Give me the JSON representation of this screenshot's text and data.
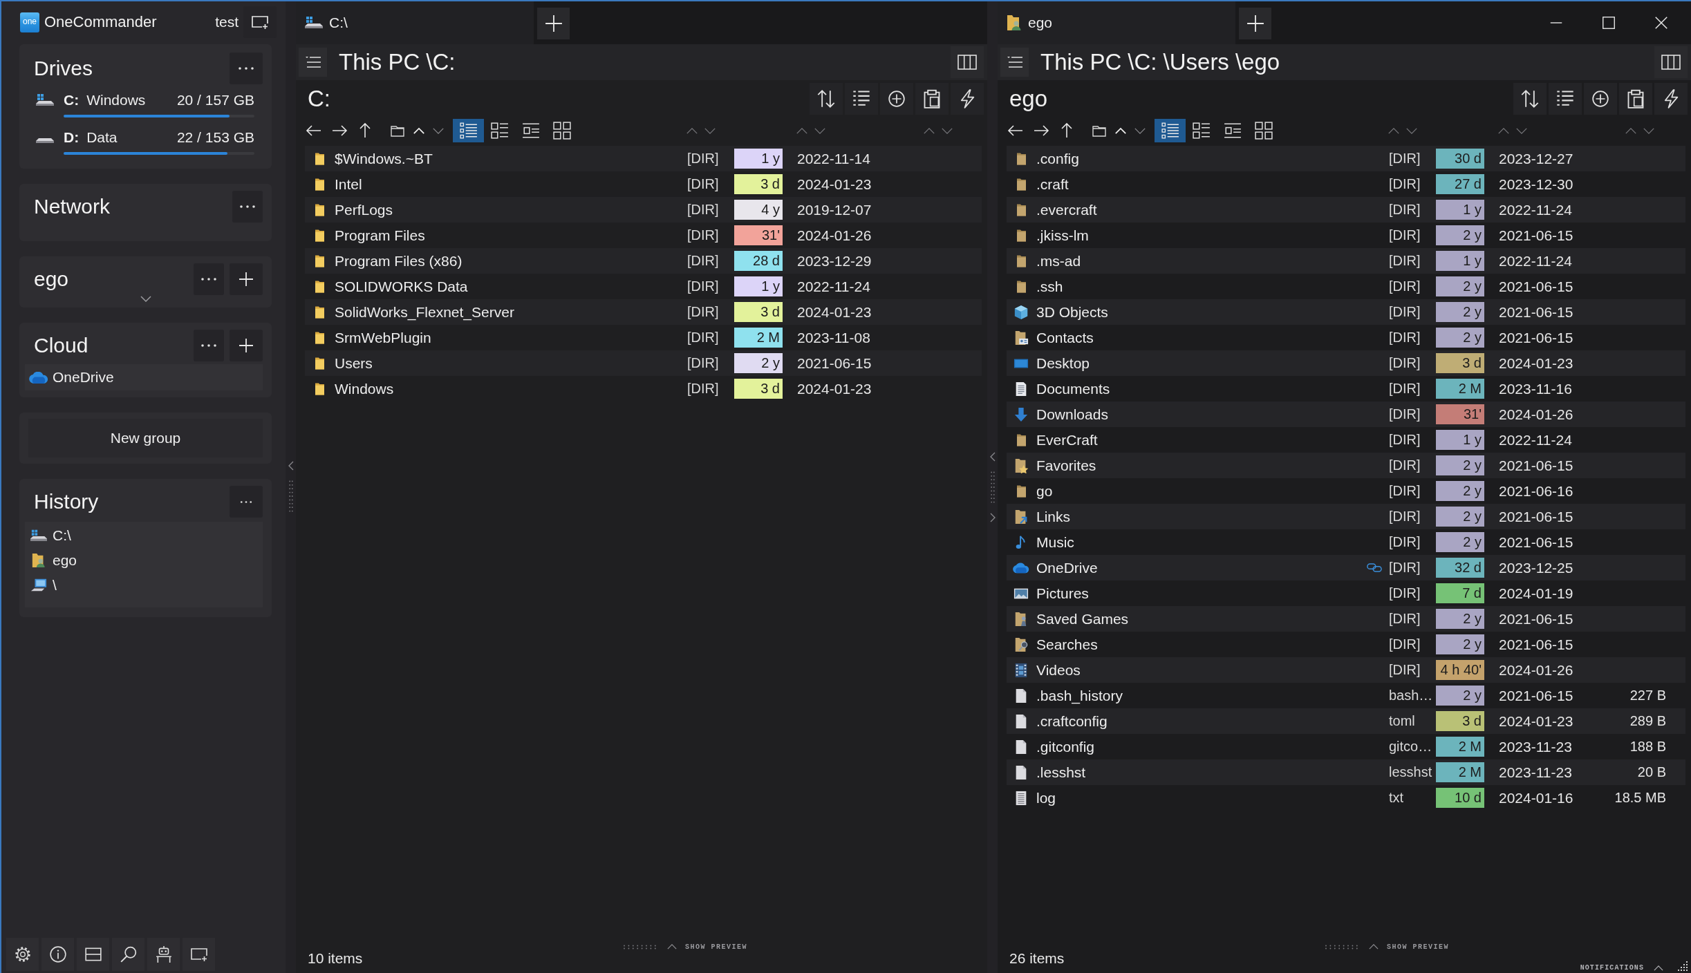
{
  "window": {
    "notifications": "NOTIFICATIONS"
  },
  "sidebar": {
    "logo": "one",
    "app_name": "OneCommander",
    "workspace": "test",
    "drives": {
      "title": "Drives",
      "items": [
        {
          "kind": "system",
          "letter": "C:",
          "label": "Windows",
          "space": "20 / 157 GB",
          "level": 0.87
        },
        {
          "kind": "data",
          "letter": "D:",
          "label": "Data",
          "space": "22 / 153 GB",
          "level": 0.86
        }
      ]
    },
    "groups": [
      {
        "title": "Network",
        "addable": false,
        "expanded": true
      },
      {
        "title": "ego",
        "addable": true,
        "expanded": false
      },
      {
        "title": "Cloud",
        "addable": true,
        "expanded": true,
        "items": [
          {
            "kind": "cloud",
            "label": "OneDrive"
          }
        ]
      }
    ],
    "new_group": "New group",
    "history": {
      "title": "History",
      "items": [
        {
          "kind": "drive",
          "label": "C:\\"
        },
        {
          "kind": "user-folder",
          "label": "ego"
        },
        {
          "kind": "computer",
          "label": "\\"
        }
      ]
    }
  },
  "panes": [
    {
      "active": true,
      "tabs": [
        {
          "kind": "drive",
          "label": "C:\\"
        }
      ],
      "breadcrumb": [
        "This PC",
        "\\C:"
      ],
      "folder": "C:",
      "view_modes": [
        {
          "kind": "details",
          "selected": true
        },
        {
          "kind": "tiles",
          "selected": false
        },
        {
          "kind": "tree",
          "selected": false
        },
        {
          "kind": "grid",
          "selected": false
        }
      ],
      "rows": [
        {
          "kind": "folder",
          "name": "$Windows.~BT",
          "type": "[DIR]",
          "linked": false,
          "age": "1 y",
          "color": "#dcd4f8",
          "date": "2022-11-14"
        },
        {
          "kind": "folder",
          "name": "Intel",
          "type": "[DIR]",
          "linked": false,
          "age": "3 d",
          "color": "#e3f29b",
          "date": "2024-01-23"
        },
        {
          "kind": "folder",
          "name": "PerfLogs",
          "type": "[DIR]",
          "linked": false,
          "age": "4 y",
          "color": "#e8e6ec",
          "date": "2019-12-07"
        },
        {
          "kind": "folder",
          "name": "Program Files",
          "type": "[DIR]",
          "linked": false,
          "age": "31'",
          "color": "#f2a39a",
          "date": "2024-01-26"
        },
        {
          "kind": "folder",
          "name": "Program Files (x86)",
          "type": "[DIR]",
          "linked": false,
          "age": "28 d",
          "color": "#8fe1ee",
          "date": "2023-12-29"
        },
        {
          "kind": "folder",
          "name": "SOLIDWORKS Data",
          "type": "[DIR]",
          "linked": false,
          "age": "1 y",
          "color": "#dcd4f8",
          "date": "2022-11-24"
        },
        {
          "kind": "folder",
          "name": "SolidWorks_Flexnet_Server",
          "type": "[DIR]",
          "linked": false,
          "age": "3 d",
          "color": "#e3f29b",
          "date": "2024-01-23"
        },
        {
          "kind": "folder",
          "name": "SrmWebPlugin",
          "type": "[DIR]",
          "linked": false,
          "age": "2 M",
          "color": "#8fe1ee",
          "date": "2023-11-08"
        },
        {
          "kind": "folder",
          "name": "Users",
          "type": "[DIR]",
          "linked": false,
          "age": "2 y",
          "color": "#e0dbf2",
          "date": "2021-06-15"
        },
        {
          "kind": "folder",
          "name": "Windows",
          "type": "[DIR]",
          "linked": false,
          "age": "3 d",
          "color": "#e3f29b",
          "date": "2024-01-23"
        }
      ],
      "status": "10 items",
      "preview": "SHOW PREVIEW"
    },
    {
      "active": false,
      "tabs": [
        {
          "kind": "user-folder",
          "label": "ego"
        }
      ],
      "breadcrumb": [
        "This PC",
        "\\C:",
        "\\Users",
        "\\ego"
      ],
      "folder": "ego",
      "view_modes": [
        {
          "kind": "details",
          "selected": true
        },
        {
          "kind": "tiles",
          "selected": false
        },
        {
          "kind": "tree",
          "selected": false
        },
        {
          "kind": "grid",
          "selected": false
        }
      ],
      "rows": [
        {
          "kind": "folder",
          "name": ".config",
          "type": "[DIR]",
          "linked": false,
          "age": "30 d",
          "color": "#6cb4bc",
          "date": "2023-12-27"
        },
        {
          "kind": "folder",
          "name": ".craft",
          "type": "[DIR]",
          "linked": false,
          "age": "27 d",
          "color": "#6cb4bc",
          "date": "2023-12-30"
        },
        {
          "kind": "folder",
          "name": ".evercraft",
          "type": "[DIR]",
          "linked": false,
          "age": "1 y",
          "color": "#a9a5c3",
          "date": "2022-11-24"
        },
        {
          "kind": "folder",
          "name": ".jkiss-lm",
          "type": "[DIR]",
          "linked": false,
          "age": "2 y",
          "color": "#a9a5c3",
          "date": "2021-06-15"
        },
        {
          "kind": "folder",
          "name": ".ms-ad",
          "type": "[DIR]",
          "linked": false,
          "age": "1 y",
          "color": "#a9a5c3",
          "date": "2022-11-24"
        },
        {
          "kind": "folder",
          "name": ".ssh",
          "type": "[DIR]",
          "linked": false,
          "age": "2 y",
          "color": "#a9a5c3",
          "date": "2021-06-15"
        },
        {
          "kind": "cube",
          "name": "3D Objects",
          "type": "[DIR]",
          "linked": false,
          "age": "2 y",
          "color": "#a9a5c3",
          "date": "2021-06-15"
        },
        {
          "kind": "contacts",
          "name": "Contacts",
          "type": "[DIR]",
          "linked": false,
          "age": "2 y",
          "color": "#a9a5c3",
          "date": "2021-06-15"
        },
        {
          "kind": "desktop",
          "name": "Desktop",
          "type": "[DIR]",
          "linked": false,
          "age": "3 d",
          "color": "#bfad75",
          "date": "2024-01-23"
        },
        {
          "kind": "document",
          "name": "Documents",
          "type": "[DIR]",
          "linked": false,
          "age": "2 M",
          "color": "#6cb4bc",
          "date": "2023-11-16"
        },
        {
          "kind": "download",
          "name": "Downloads",
          "type": "[DIR]",
          "linked": false,
          "age": "31'",
          "color": "#c47d77",
          "date": "2024-01-26"
        },
        {
          "kind": "folder",
          "name": "EverCraft",
          "type": "[DIR]",
          "linked": false,
          "age": "1 y",
          "color": "#a9a5c3",
          "date": "2022-11-24"
        },
        {
          "kind": "star-folder",
          "name": "Favorites",
          "type": "[DIR]",
          "linked": false,
          "age": "2 y",
          "color": "#a9a5c3",
          "date": "2021-06-15"
        },
        {
          "kind": "folder",
          "name": "go",
          "type": "[DIR]",
          "linked": false,
          "age": "2 y",
          "color": "#a9a5c3",
          "date": "2021-06-16"
        },
        {
          "kind": "link-folder",
          "name": "Links",
          "type": "[DIR]",
          "linked": false,
          "age": "2 y",
          "color": "#a9a5c3",
          "date": "2021-06-15"
        },
        {
          "kind": "music",
          "name": "Music",
          "type": "[DIR]",
          "linked": false,
          "age": "2 y",
          "color": "#a9a5c3",
          "date": "2021-06-15"
        },
        {
          "kind": "cloud",
          "name": "OneDrive",
          "type": "[DIR]",
          "linked": true,
          "age": "32 d",
          "color": "#6cb4bc",
          "date": "2023-12-25"
        },
        {
          "kind": "picture",
          "name": "Pictures",
          "type": "[DIR]",
          "linked": false,
          "age": "7 d",
          "color": "#76c276",
          "date": "2024-01-19"
        },
        {
          "kind": "game-folder",
          "name": "Saved Games",
          "type": "[DIR]",
          "linked": false,
          "age": "2 y",
          "color": "#a9a5c3",
          "date": "2021-06-15"
        },
        {
          "kind": "search-folder",
          "name": "Searches",
          "type": "[DIR]",
          "linked": false,
          "age": "2 y",
          "color": "#a9a5c3",
          "date": "2021-06-15"
        },
        {
          "kind": "video",
          "name": "Videos",
          "type": "[DIR]",
          "linked": false,
          "age": "4 h 40'",
          "color": "#c4a26c",
          "date": "2024-01-26"
        },
        {
          "kind": "file",
          "name": ".bash_history",
          "type": "bash…",
          "linked": false,
          "age": "2 y",
          "color": "#a9a5c3",
          "date": "2021-06-15",
          "size": "227 B"
        },
        {
          "kind": "file",
          "name": ".craftconfig",
          "type": "toml",
          "linked": false,
          "age": "3 d",
          "color": "#b9c176",
          "date": "2024-01-23",
          "size": "289 B"
        },
        {
          "kind": "file",
          "name": ".gitconfig",
          "type": "gitco…",
          "linked": false,
          "age": "2 M",
          "color": "#6cb4bc",
          "date": "2023-11-23",
          "size": "188 B"
        },
        {
          "kind": "file",
          "name": ".lesshst",
          "type": "lesshst",
          "linked": false,
          "age": "2 M",
          "color": "#6cb4bc",
          "date": "2023-11-23",
          "size": "20 B"
        },
        {
          "kind": "text-file",
          "name": "log",
          "type": "txt",
          "linked": false,
          "age": "10 d",
          "color": "#76c276",
          "date": "2024-01-16",
          "size": "18.5 MB"
        }
      ],
      "status": "26 items",
      "preview": "SHOW PREVIEW"
    }
  ]
}
